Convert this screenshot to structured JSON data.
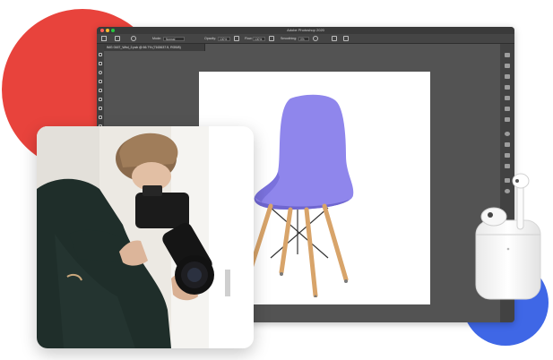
{
  "window": {
    "title": "Adobe Photoshop 2020",
    "dots": [
      "#ff5f57",
      "#febc2e",
      "#28c840"
    ]
  },
  "options_bar": {
    "mode_label": "Mode:",
    "mode_value": "Normal",
    "opacity_label": "Opacity:",
    "opacity_value": "100%",
    "flow_label": "Flow:",
    "flow_value": "100%",
    "smoothing_label": "Smoothing:",
    "smoothing_value": "0%"
  },
  "document_tab": {
    "label": "IMG 0167_Wbd_2.psb @ 66.7% (7163637.5, RGB/8)"
  },
  "colors": {
    "accent_red": "#e8433c",
    "accent_blue": "#3f67e6",
    "chair_purple": "#8f86ec",
    "ps_dark": "#535353"
  },
  "icons": [
    "home-icon",
    "brush-icon",
    "gear-icon",
    "airbrush-icon",
    "pressure-icon",
    "symmetry-icon"
  ]
}
